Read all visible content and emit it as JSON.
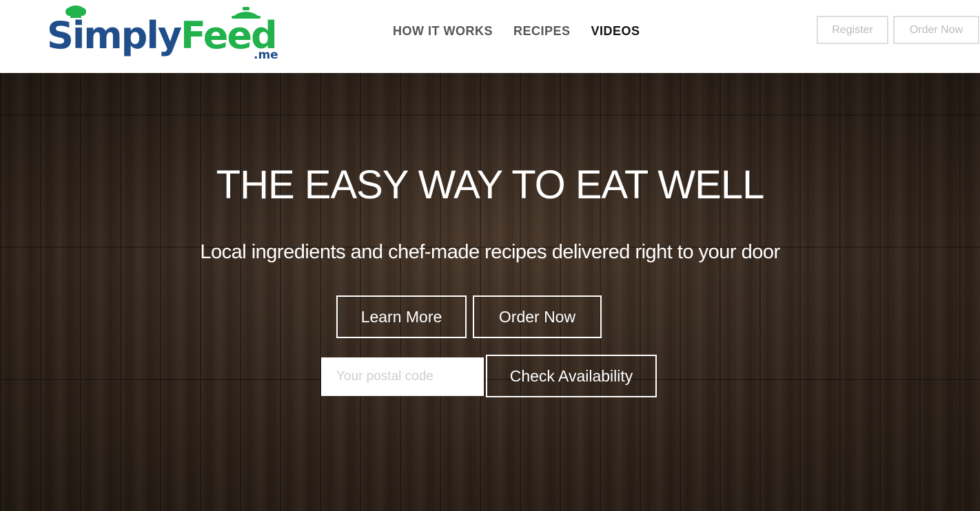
{
  "brand": {
    "name_part1": "Simply",
    "name_part2": "Feed",
    "suffix": ".me",
    "primary_color": "#1f4e8a",
    "accent_color": "#21b24b"
  },
  "nav": {
    "items": [
      {
        "label": "HOW IT WORKS",
        "active": false
      },
      {
        "label": "RECIPES",
        "active": false
      },
      {
        "label": "VIDEOS",
        "active": true
      }
    ]
  },
  "header_buttons": {
    "register": "Register",
    "order_now": "Order Now"
  },
  "hero": {
    "title": "THE EASY WAY TO EAT WELL",
    "subtitle": "Local ingredients and chef-made recipes delivered right to your door",
    "learn_more": "Learn More",
    "order_now": "Order Now",
    "postal_placeholder": "Your postal code",
    "postal_value": "",
    "check_availability": "Check Availability",
    "background": "dark-wood-texture"
  }
}
